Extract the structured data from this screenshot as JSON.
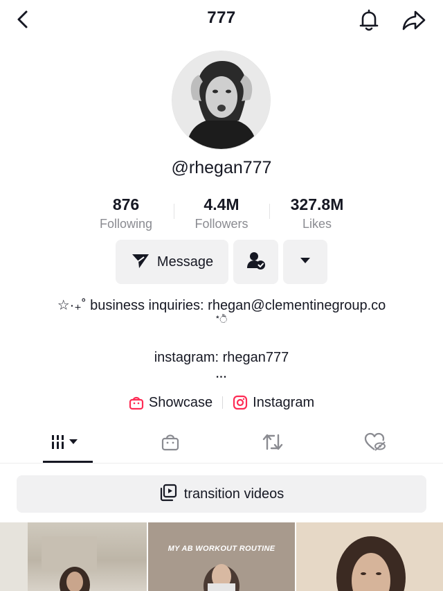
{
  "header": {
    "title": "777",
    "back_icon": "chevron-left-icon",
    "bell_icon": "bell-icon",
    "share_icon": "share-arrow-icon"
  },
  "profile": {
    "username": "@rhegan777"
  },
  "stats": [
    {
      "value": "876",
      "label": "Following"
    },
    {
      "value": "4.4M",
      "label": "Followers"
    },
    {
      "value": "327.8M",
      "label": "Likes"
    }
  ],
  "actions": {
    "message_label": "Message",
    "friend_icon": "person-check-icon",
    "more_icon": "caret-down-icon"
  },
  "bio": {
    "line1": "☆·₊˚ business inquiries: rhegan@clementinegroup.co",
    "line2": "*ੈ",
    "line3": "instagram: rhegan777",
    "line4": "..."
  },
  "links": [
    {
      "label": "Showcase",
      "icon": "shopping-bag-icon"
    },
    {
      "label": "Instagram",
      "icon": "instagram-icon"
    }
  ],
  "tabs": [
    {
      "name": "videos",
      "icon": "grid-bars-icon",
      "active": true
    },
    {
      "name": "shop",
      "icon": "bag-icon"
    },
    {
      "name": "reposts",
      "icon": "repost-icon"
    },
    {
      "name": "liked",
      "icon": "heart-hidden-icon"
    }
  ],
  "playlist": {
    "label": "transition videos"
  },
  "thumbnails": [
    {
      "caption": ""
    },
    {
      "caption": "MY AB WORKOUT ROUTINE"
    },
    {
      "caption": ""
    }
  ],
  "colors": {
    "accent": "#fe2c55",
    "text": "#161823",
    "muted": "#8a8b91",
    "button_bg": "#f1f1f2"
  }
}
